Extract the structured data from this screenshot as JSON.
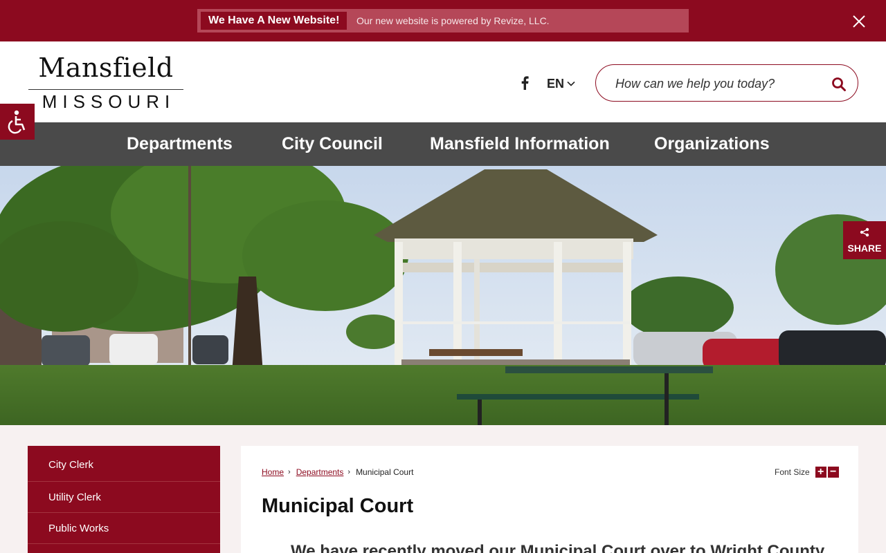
{
  "alert": {
    "tag": "We Have A New Website!",
    "text": "Our new website is powered by Revize, LLC."
  },
  "header": {
    "logo_main": "Mansfield",
    "logo_sub": "MISSOURI",
    "language": "EN",
    "search_placeholder": "How can we help you today?"
  },
  "nav": {
    "items": [
      "Departments",
      "City Council",
      "Mansfield Information",
      "Organizations"
    ]
  },
  "share": {
    "label": "SHARE"
  },
  "sidebar": {
    "items": [
      "City Clerk",
      "Utility Clerk",
      "Public Works"
    ]
  },
  "content": {
    "breadcrumb": [
      "Home",
      "Departments",
      "Municipal Court"
    ],
    "font_size_label": "Font Size",
    "font_plus": "+",
    "font_minus": "−",
    "title": "Municipal Court",
    "intro": "We have recently moved our Municipal Court over to Wright County"
  },
  "colors": {
    "brand": "#8c0a1f",
    "nav_bg": "#4a4a4a"
  }
}
